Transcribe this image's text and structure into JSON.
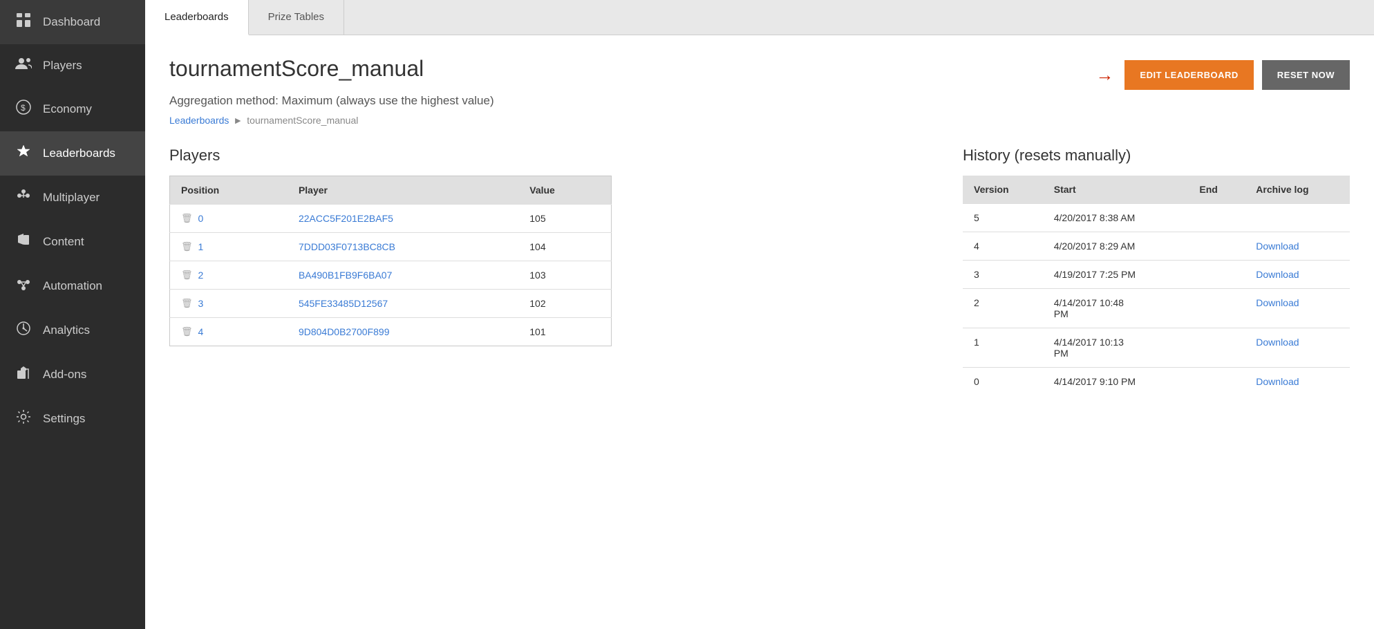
{
  "sidebar": {
    "items": [
      {
        "id": "dashboard",
        "label": "Dashboard",
        "icon": "⊞",
        "active": false
      },
      {
        "id": "players",
        "label": "Players",
        "icon": "👥",
        "active": false
      },
      {
        "id": "economy",
        "label": "Economy",
        "icon": "💲",
        "active": false
      },
      {
        "id": "leaderboards",
        "label": "Leaderboards",
        "icon": "🏆",
        "active": true
      },
      {
        "id": "multiplayer",
        "label": "Multiplayer",
        "icon": "⚙",
        "active": false
      },
      {
        "id": "content",
        "label": "Content",
        "icon": "📢",
        "active": false
      },
      {
        "id": "automation",
        "label": "Automation",
        "icon": "🤖",
        "active": false
      },
      {
        "id": "analytics",
        "label": "Analytics",
        "icon": "📊",
        "active": false
      },
      {
        "id": "addons",
        "label": "Add-ons",
        "icon": "🔌",
        "active": false
      },
      {
        "id": "settings",
        "label": "Settings",
        "icon": "⚙",
        "active": false
      }
    ]
  },
  "tabs": [
    {
      "id": "leaderboards",
      "label": "Leaderboards",
      "active": true
    },
    {
      "id": "prize-tables",
      "label": "Prize Tables",
      "active": false
    }
  ],
  "page": {
    "title": "tournamentScore_manual",
    "aggregation_method": "Aggregation method: Maximum (always use the highest value)",
    "edit_button": "EDIT LEADERBOARD",
    "reset_button": "RESET NOW",
    "breadcrumb_parent": "Leaderboards",
    "breadcrumb_current": "tournamentScore_manual"
  },
  "players_section": {
    "title": "Players",
    "table": {
      "headers": [
        "Position",
        "Player",
        "Value"
      ],
      "rows": [
        {
          "position": "0",
          "player": "22ACC5F201E2BAF5",
          "value": "105"
        },
        {
          "position": "1",
          "player": "7DDD03F0713BC8CB",
          "value": "104"
        },
        {
          "position": "2",
          "player": "BA490B1FB9F6BA07",
          "value": "103"
        },
        {
          "position": "3",
          "player": "545FE33485D12567",
          "value": "102"
        },
        {
          "position": "4",
          "player": "9D804D0B2700F899",
          "value": "101"
        }
      ]
    }
  },
  "history_section": {
    "title": "History (resets manually)",
    "table": {
      "headers": [
        "Version",
        "Start",
        "End",
        "Archive log"
      ],
      "rows": [
        {
          "version": "5",
          "start": "4/20/2017 8:38 AM",
          "end": "",
          "archive_log": ""
        },
        {
          "version": "4",
          "start": "4/20/2017 8:29 AM",
          "end": "",
          "archive_log": "Download"
        },
        {
          "version": "3",
          "start": "4/19/2017 7:25 PM",
          "end": "",
          "archive_log": "Download"
        },
        {
          "version": "2",
          "start": "4/14/2017 10:48\nPM",
          "end": "",
          "archive_log": "Download"
        },
        {
          "version": "1",
          "start": "4/14/2017 10:13\nPM",
          "end": "",
          "archive_log": "Download"
        },
        {
          "version": "0",
          "start": "4/14/2017 9:10 PM",
          "end": "",
          "archive_log": "Download"
        }
      ]
    }
  }
}
